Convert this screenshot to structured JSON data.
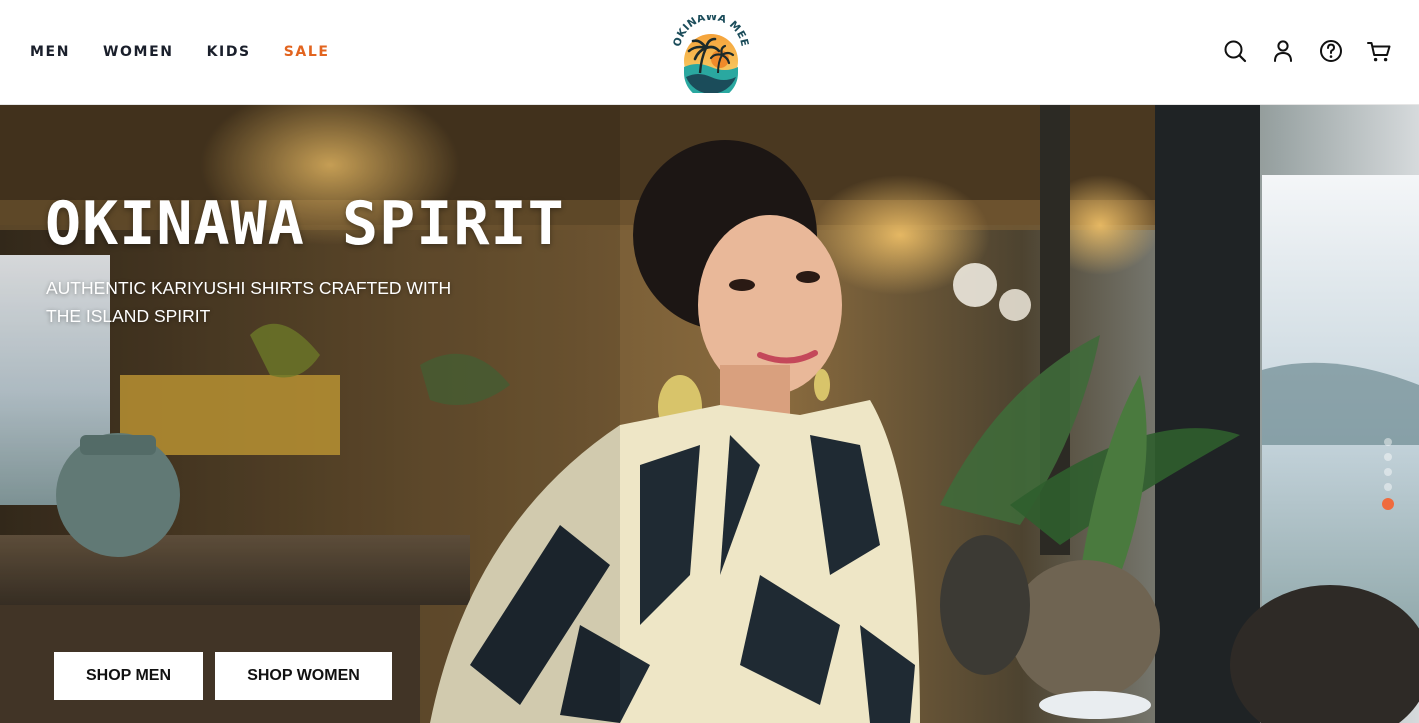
{
  "nav": {
    "items": [
      {
        "label": "MEN"
      },
      {
        "label": "WOMEN"
      },
      {
        "label": "KIDS"
      },
      {
        "label": "SALE",
        "color": "#e2641f"
      }
    ]
  },
  "brand": {
    "logo_text": "OKINAWA MEE",
    "logo_icons": [
      "palm-tree-icon",
      "sun-icon",
      "wave-icon"
    ]
  },
  "header_icons": [
    "search-icon",
    "account-icon",
    "help-icon",
    "cart-icon"
  ],
  "hero": {
    "title": "OKINAWA SPIRIT",
    "subtitle": "AUTHENTIC KARIYUSHI SHIRTS CRAFTED WITH THE ISLAND SPIRIT",
    "cta_men": "SHOP MEN",
    "cta_women": "SHOP WOMEN",
    "slide_count": 5,
    "active_slide": 5,
    "accent_color": "#f06b3d"
  }
}
